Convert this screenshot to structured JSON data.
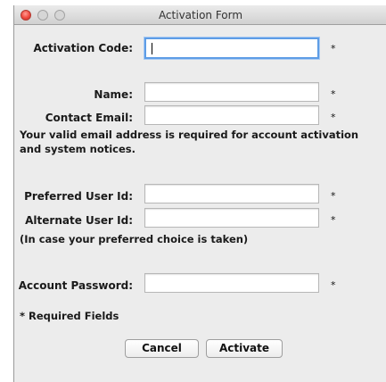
{
  "window": {
    "title": "Activation Form"
  },
  "form": {
    "activation_code": {
      "label": "Activation Code:",
      "value": "",
      "required_mark": "*"
    },
    "name": {
      "label": "Name:",
      "value": "",
      "required_mark": "*"
    },
    "contact_email": {
      "label": "Contact Email:",
      "value": "",
      "required_mark": "*"
    },
    "email_note": "Your valid email address is required for account activation and system notices.",
    "preferred_user_id": {
      "label": "Preferred User Id:",
      "value": "",
      "required_mark": "*"
    },
    "alternate_user_id": {
      "label": "Alternate User Id:",
      "value": "",
      "required_mark": "*"
    },
    "alternate_note": "(In case your preferred choice is taken)",
    "account_password": {
      "label": "Account Password:",
      "value": "",
      "required_mark": "*"
    },
    "required_fields_note": "* Required Fields"
  },
  "buttons": {
    "cancel": "Cancel",
    "activate": "Activate"
  }
}
